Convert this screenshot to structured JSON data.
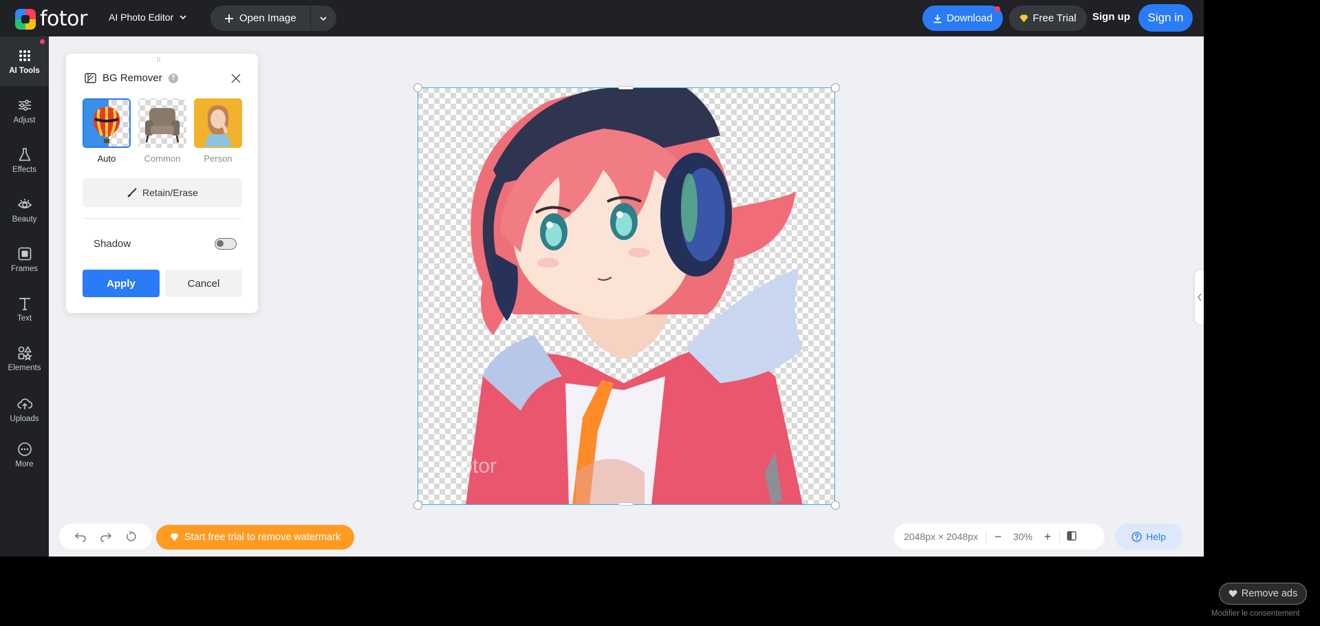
{
  "topbar": {
    "logo_text": "fotor",
    "app_menu_label": "AI Photo Editor",
    "open_image_label": "Open Image",
    "download_label": "Download",
    "free_trial_label": "Free Trial",
    "signup_label": "Sign up",
    "signin_label": "Sign in"
  },
  "sidebar": {
    "items": [
      {
        "label": "AI Tools",
        "icon": "grid-dots-icon"
      },
      {
        "label": "Adjust",
        "icon": "sliders-icon"
      },
      {
        "label": "Effects",
        "icon": "flask-icon"
      },
      {
        "label": "Beauty",
        "icon": "eye-icon"
      },
      {
        "label": "Frames",
        "icon": "frame-icon"
      },
      {
        "label": "Text",
        "icon": "text-icon"
      },
      {
        "label": "Elements",
        "icon": "shapes-icon"
      },
      {
        "label": "Uploads",
        "icon": "cloud-upload-icon"
      },
      {
        "label": "More",
        "icon": "more-dots-icon"
      }
    ]
  },
  "panel": {
    "drag_handle": "⠿",
    "title": "BG Remover",
    "help": "?",
    "modes": [
      {
        "label": "Auto",
        "selected": true
      },
      {
        "label": "Common",
        "selected": false
      },
      {
        "label": "Person",
        "selected": false
      }
    ],
    "retain_erase_label": "Retain/Erase",
    "shadow_label": "Shadow",
    "shadow_enabled": false,
    "apply_label": "Apply",
    "cancel_label": "Cancel"
  },
  "canvas": {
    "watermark": "Fotor"
  },
  "bottombar": {
    "watermark_cta": "Start free trial to remove watermark",
    "dimensions": "2048px × 2048px",
    "zoom_minus": "−",
    "zoom_value": "30%",
    "zoom_plus": "+",
    "help_label": "Help"
  },
  "ads": {
    "remove_ads_label": "Remove ads",
    "consent_label": "Modifier le consentement"
  },
  "colors": {
    "accent": "#2a7bf6",
    "trial_orange": "#ff9b21",
    "chrome_dark": "#1f2125",
    "workspace_bg": "#eef0f3"
  }
}
